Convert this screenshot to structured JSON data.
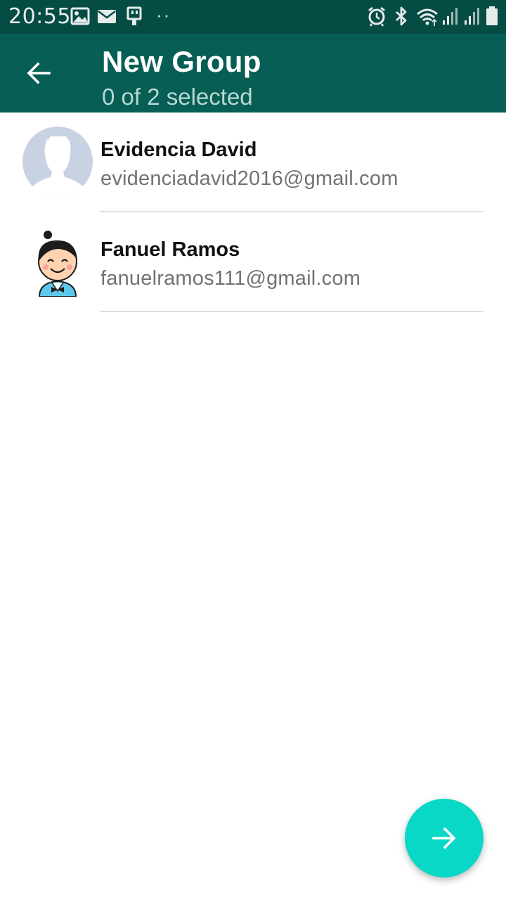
{
  "status_bar": {
    "time": "20:55",
    "dots": "··",
    "left_icons": [
      "image-icon",
      "mail-icon",
      "usb-icon"
    ],
    "right_icons": [
      "alarm-icon",
      "bluetooth-icon",
      "wifi-icon",
      "signal-icon",
      "signal-icon",
      "battery-icon"
    ]
  },
  "app_bar": {
    "back_icon": "arrow-left-icon",
    "title": "New Group",
    "subtitle": "0 of 2 selected"
  },
  "contacts": [
    {
      "name": "Evidencia David",
      "email": "evidenciadavid2016@gmail.com",
      "avatar": "default-person-avatar"
    },
    {
      "name": "Fanuel Ramos",
      "email": "fanuelramos111@gmail.com",
      "avatar": "cartoon-boy-avatar"
    }
  ],
  "fab": {
    "icon": "arrow-right-icon"
  },
  "colors": {
    "status_bar": "#054c44",
    "app_bar": "#075e54",
    "fab": "#09d8c6",
    "avatar_placeholder": "#c8d2e2"
  }
}
